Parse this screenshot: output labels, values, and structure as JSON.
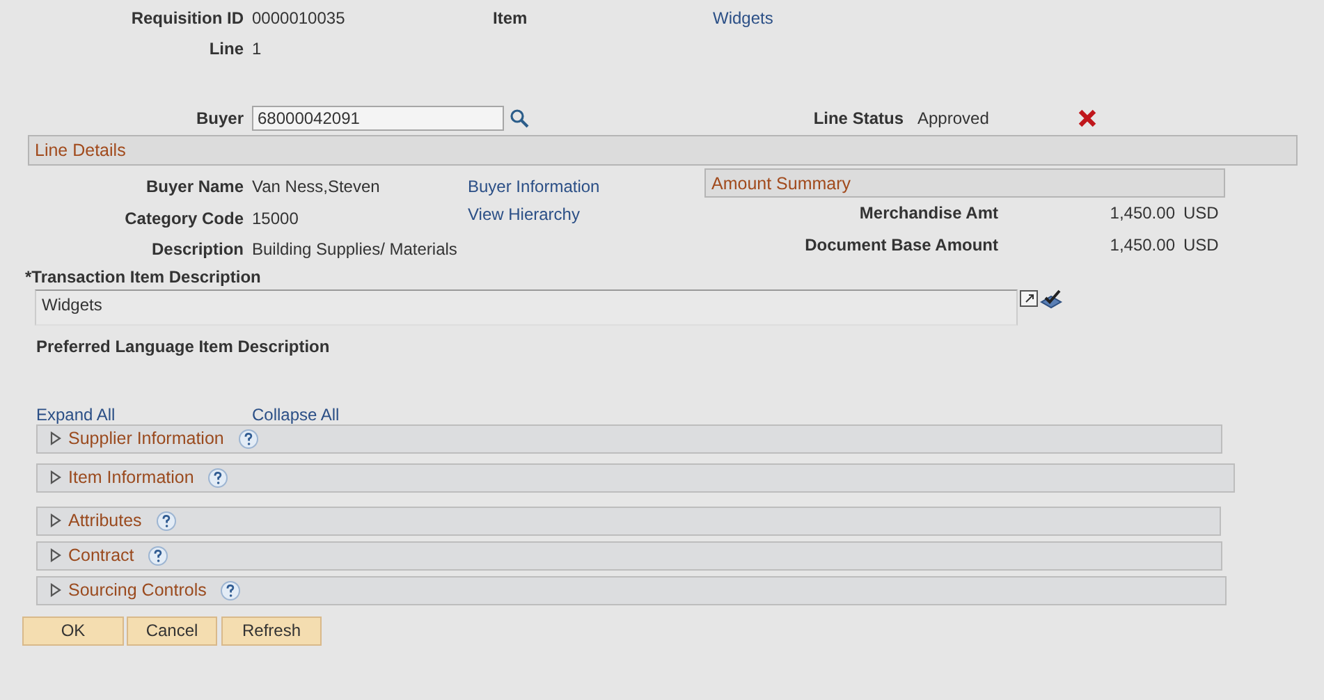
{
  "header": {
    "requisition_id": {
      "label": "Requisition ID",
      "value": "0000010035"
    },
    "item": {
      "label": "Item",
      "value": "Widgets"
    },
    "line": {
      "label": "Line",
      "value": "1"
    },
    "buyer": {
      "label": "Buyer",
      "value": "68000042091"
    },
    "line_status": {
      "label": "Line Status",
      "value": "Approved"
    }
  },
  "line_details": {
    "title": "Line Details",
    "fields": [
      {
        "label": "Buyer Name",
        "value": "Van Ness,Steven",
        "link": "Buyer Information"
      },
      {
        "label": "Category Code",
        "value": "15000",
        "link": "View Hierarchy"
      },
      {
        "label": "Description",
        "value": "Building Supplies/ Materials"
      }
    ],
    "amount_summary": {
      "title": "Amount Summary",
      "rows": [
        {
          "label": "Merchandise Amt",
          "value": "1,450.00",
          "currency": "USD"
        },
        {
          "label": "Document Base Amount",
          "value": "1,450.00",
          "currency": "USD"
        }
      ]
    }
  },
  "transaction_item_description": {
    "label": "*Transaction Item Description",
    "value": "Widgets"
  },
  "preferred_language_label": "Preferred Language Item Description",
  "expand_all": "Expand All",
  "collapse_all": "Collapse All",
  "sections": [
    {
      "title": "Supplier Information",
      "expanded": false
    },
    {
      "title": "Item Information",
      "expanded": false
    },
    {
      "title": "Attributes",
      "expanded": false
    },
    {
      "title": "Contract",
      "expanded": false
    },
    {
      "title": "Sourcing Controls",
      "expanded": false
    }
  ],
  "buttons": [
    "OK",
    "Cancel",
    "Refresh"
  ]
}
